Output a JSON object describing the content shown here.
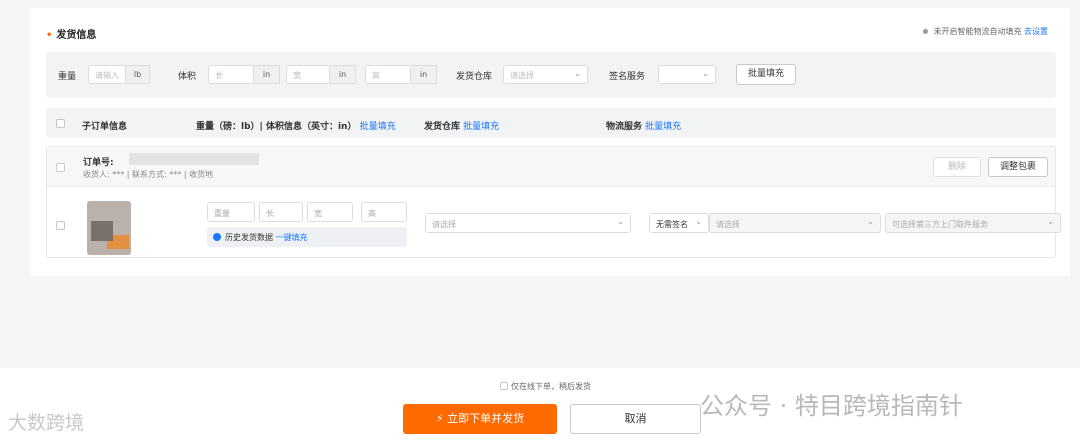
{
  "section": {
    "title": "发货信息",
    "tip_text": "未开启智能物流自动填充",
    "tip_link": "去设置"
  },
  "batch": {
    "weight_label": "重量",
    "weight_placeholder": "请输入",
    "weight_unit": "lb",
    "volume_label": "体积",
    "length_placeholder": "长",
    "width_placeholder": "宽",
    "height_placeholder": "高",
    "dim_unit": "in",
    "warehouse_label": "发货仓库",
    "warehouse_placeholder": "请选择",
    "sign_label": "签名服务",
    "sign_value": "",
    "fill_button": "批量填充"
  },
  "table_header": {
    "sub_order": "子订单信息",
    "weight_dims": "重量（磅：lb）| 体积信息（英寸：in）",
    "weight_dims_link": "批量填充",
    "warehouse": "发货仓库",
    "warehouse_link": "批量填充",
    "logistics": "物流服务",
    "logistics_link": "批量填充"
  },
  "order": {
    "order_no_label": "订单号:",
    "receiver_label": "收货人:",
    "receiver_value": "***",
    "contact_label": "联系方式:",
    "contact_value": "***",
    "address_label": "收货地",
    "delete_button": "删除",
    "adjust_button": "调整包裹",
    "weight_placeholder": "重量",
    "length_placeholder": "长",
    "width_placeholder": "宽",
    "height_placeholder": "高",
    "history_text": "历史发货数据",
    "history_link": "一键填充",
    "warehouse_placeholder": "请选择",
    "sign_value": "无需签名",
    "logistics_placeholder": "请选择",
    "pickup_placeholder": "可选择第三方上门取件服务"
  },
  "footer": {
    "offline_checkbox_label": "仅在线下单，稍后发货",
    "confirm_button": "立即下单并发货",
    "confirm_icon": "⚡",
    "cancel_button": "取消"
  },
  "watermarks": {
    "left": "大数跨境",
    "right": "公众号 · 特目跨境指南针"
  }
}
